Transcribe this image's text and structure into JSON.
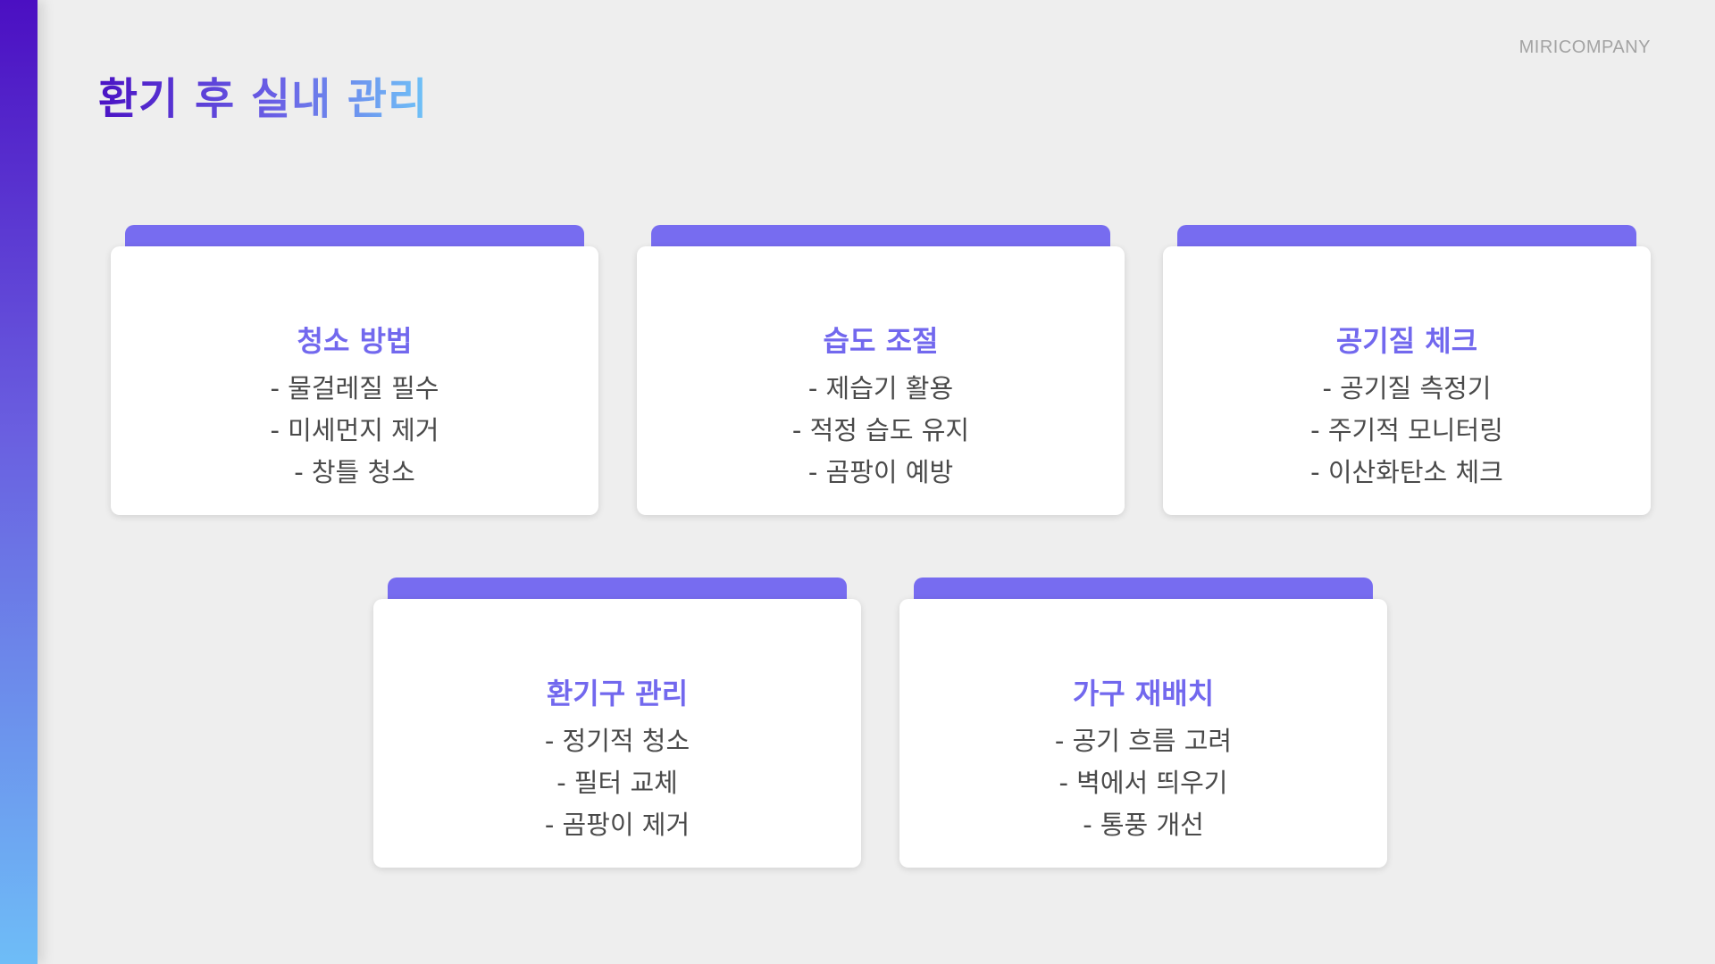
{
  "brand": "MIRICOMPANY",
  "title": "환기 후 실내 관리",
  "colors": {
    "accent": "#776cf0",
    "title_gradient_start": "#4a12c4",
    "title_gradient_end": "#6fc3f7",
    "background": "#eeeeee",
    "card": "#ffffff",
    "item_text": "#4a4a4a"
  },
  "cards": [
    {
      "title": "청소 방법",
      "items": [
        "- 물걸레질 필수",
        "- 미세먼지 제거",
        "- 창틀 청소"
      ]
    },
    {
      "title": "습도 조절",
      "items": [
        "- 제습기 활용",
        "- 적정 습도 유지",
        "- 곰팡이 예방"
      ]
    },
    {
      "title": "공기질 체크",
      "items": [
        "- 공기질 측정기",
        "- 주기적 모니터링",
        "- 이산화탄소 체크"
      ]
    },
    {
      "title": "환기구 관리",
      "items": [
        "- 정기적 청소",
        "- 필터 교체",
        "- 곰팡이 제거"
      ]
    },
    {
      "title": "가구 재배치",
      "items": [
        "- 공기 흐름 고려",
        "- 벽에서 띄우기",
        "- 통풍 개선"
      ]
    }
  ]
}
